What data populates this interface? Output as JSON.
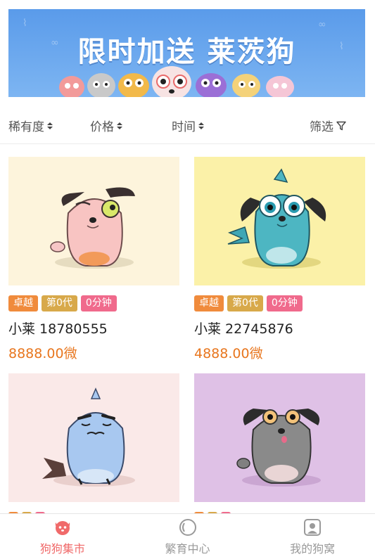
{
  "banner": {
    "title": "限时加送 莱茨狗"
  },
  "filters": {
    "rarity": "稀有度",
    "price": "价格",
    "time": "时间",
    "filter": "筛选"
  },
  "cards": [
    {
      "tags": [
        "卓越",
        "第0代",
        "0分钟"
      ],
      "name": "小莱 18780555",
      "price": "8888.00微",
      "bg": "#fdf4dc"
    },
    {
      "tags": [
        "卓越",
        "第0代",
        "0分钟"
      ],
      "name": "小莱 22745876",
      "price": "4888.00微",
      "bg": "#fbf1a8"
    },
    {
      "tags": [
        "",
        "",
        ""
      ],
      "name": "",
      "price": "",
      "bg": "#fae9e8"
    },
    {
      "tags": [
        "",
        "",
        ""
      ],
      "name": "",
      "price": "",
      "bg": "#dfc1e6"
    }
  ],
  "colors": {
    "tag_rarity": "#f08b3c",
    "tag_generation": "#d8a94a",
    "tag_time": "#f06a8c",
    "price": "#e8761e",
    "nav_active": "#f06a6a",
    "nav_inactive": "#9a9a9a"
  },
  "nav": {
    "items": [
      {
        "label": "狗狗集市",
        "icon": "dog-face-icon",
        "active": true
      },
      {
        "label": "繁育中心",
        "icon": "ring-icon",
        "active": false
      },
      {
        "label": "我的狗窝",
        "icon": "profile-icon",
        "active": false
      }
    ]
  }
}
